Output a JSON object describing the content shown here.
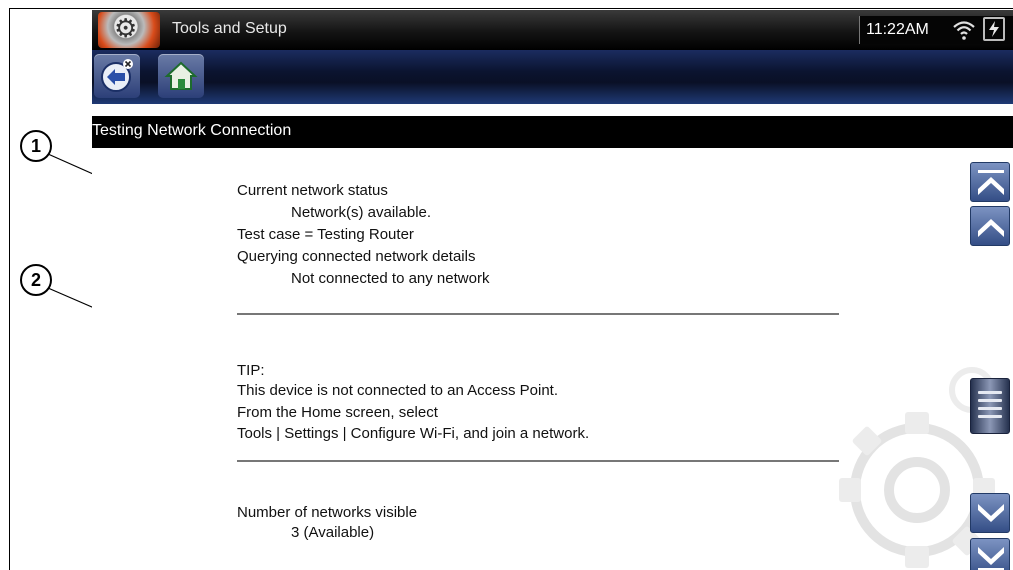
{
  "callouts": [
    "1",
    "2"
  ],
  "app": {
    "title": "Tools and Setup",
    "icon": "tools-gear-icon"
  },
  "status": {
    "time": "11:22AM",
    "wifi_icon": "wifi-icon",
    "battery_icon": "battery-charging-icon"
  },
  "toolbar": {
    "back_icon": "back-exit-icon",
    "home_icon": "home-icon"
  },
  "screen": {
    "title": "Testing Network Connection"
  },
  "content": {
    "status_heading": "Current network status",
    "status_value": "Network(s) available.",
    "test_case": "Test case = Testing Router",
    "query_heading": "Querying connected network details",
    "query_value": "Not connected to any network",
    "tip_heading": "TIP:",
    "tip_line1": "This device is not connected to an Access Point.",
    "tip_line2": "From the Home screen, select",
    "tip_line3": "Tools | Settings | Configure Wi-Fi, and join a network.",
    "networks_heading": "Number of networks visible",
    "networks_value": "3 (Available)"
  },
  "scrollbar": {
    "icons": [
      "scroll-top-icon",
      "scroll-up-icon",
      "scroll-thumb-icon",
      "scroll-down-icon",
      "scroll-bottom-icon"
    ]
  },
  "colors": {
    "title_bar": "#000000",
    "toolbar": "#0b1430",
    "button_blue": "#344e86",
    "text": "#111111"
  }
}
